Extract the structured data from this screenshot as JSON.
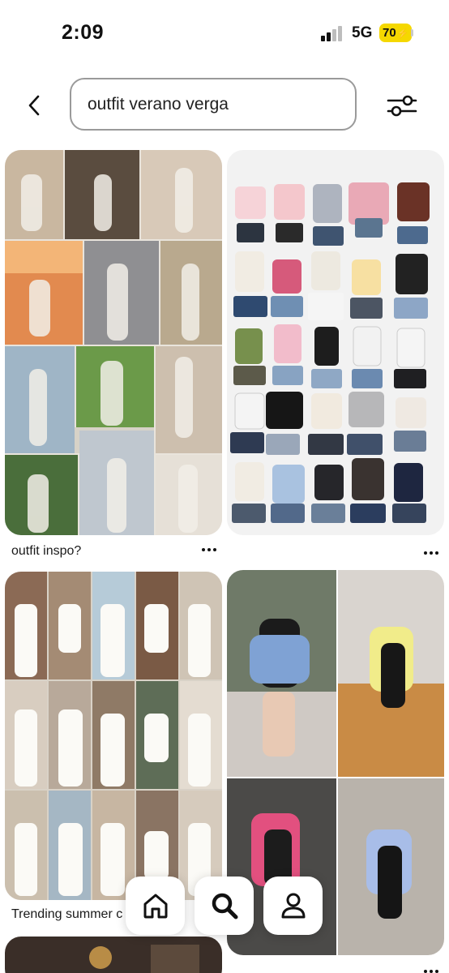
{
  "status_bar": {
    "time": "2:09",
    "network": "5G",
    "battery": "70",
    "battery_color": "#f5d800"
  },
  "header": {
    "back_icon": "chevron-left-icon",
    "search_query": "outfit verano verga",
    "filter_icon": "sliders-icon"
  },
  "pins": [
    {
      "title": "outfit inspo?",
      "more_icon": "more-horizontal-icon",
      "kind": "photo-collage"
    },
    {
      "title": "",
      "more_icon": "more-horizontal-icon",
      "kind": "product-grid"
    },
    {
      "title": "Trending summer c",
      "kind": "photo-collage"
    },
    {
      "title": "",
      "kind": "photo-collage"
    },
    {
      "title": "",
      "kind": "photo"
    }
  ],
  "bottom_nav": [
    {
      "label": "Home",
      "icon": "home-icon"
    },
    {
      "label": "Search",
      "icon": "search-icon",
      "selected": true
    },
    {
      "label": "Profile",
      "icon": "profile-icon"
    }
  ]
}
